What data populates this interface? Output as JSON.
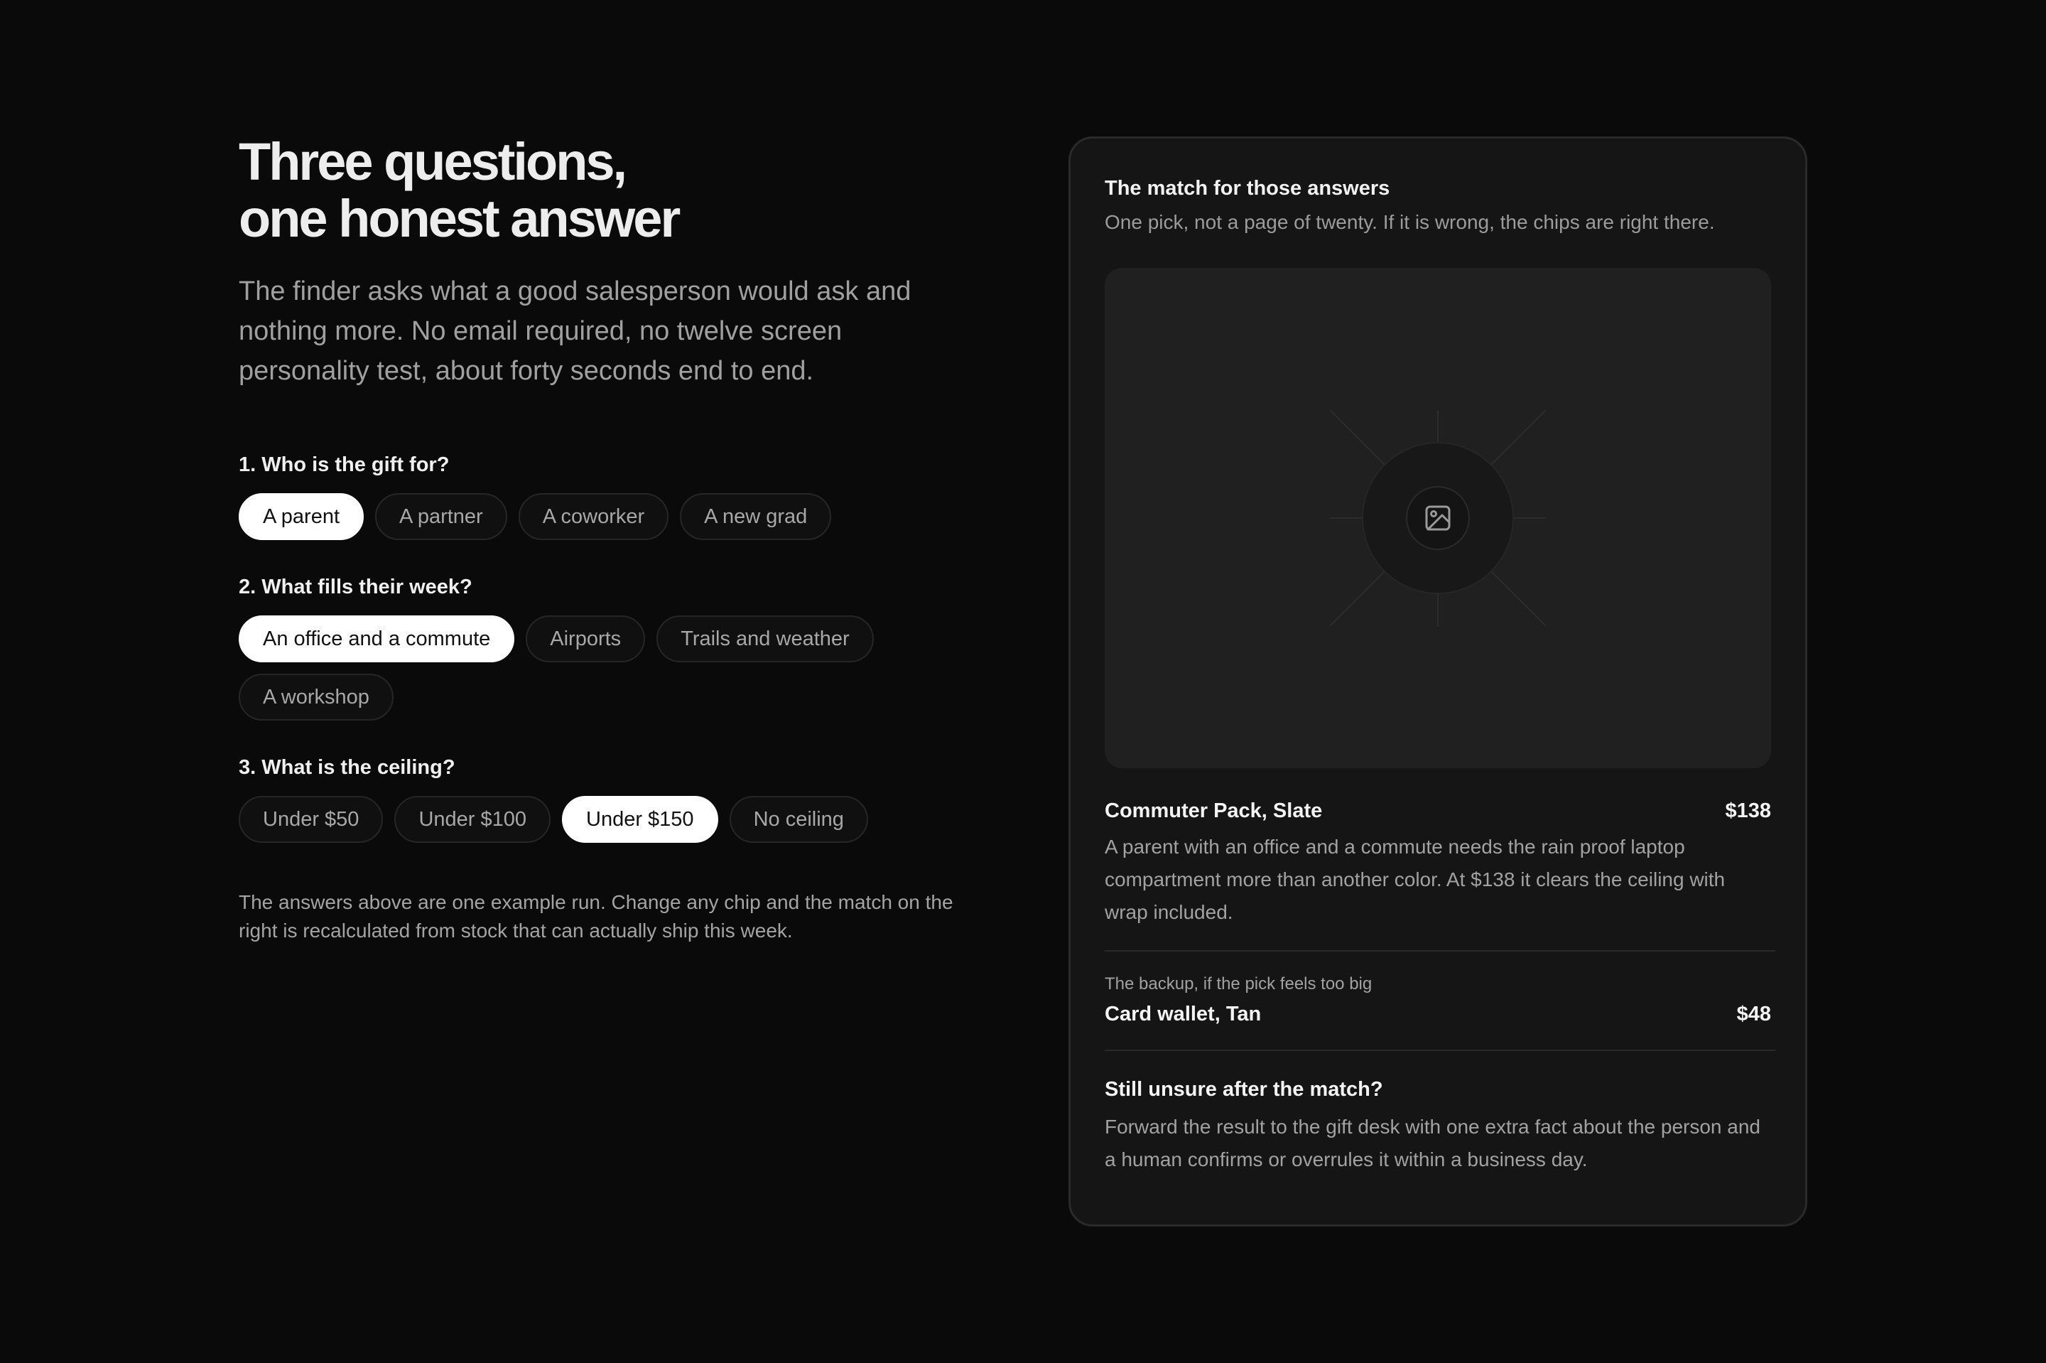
{
  "hero": {
    "title_line1": "Three questions,",
    "title_line2": "one honest answer",
    "lede": "The finder asks what a good salesperson would ask and nothing more. No email required, no twelve screen personality test, about forty seconds end to end."
  },
  "questions": [
    {
      "label": "1. Who is the gift for?",
      "options": [
        "A parent",
        "A partner",
        "A coworker",
        "A new grad"
      ],
      "selected": "A parent"
    },
    {
      "label": "2. What fills their week?",
      "options": [
        "An office and a commute",
        "Airports",
        "Trails and weather",
        "A workshop"
      ],
      "selected": "An office and a commute"
    },
    {
      "label": "3. What is the ceiling?",
      "options": [
        "Under $50",
        "Under $100",
        "Under $150",
        "No ceiling"
      ],
      "selected": "Under $150"
    }
  ],
  "note": "The answers above are one example run. Change any chip and the match on the right is recalculated from stock that can actually ship this week.",
  "match": {
    "title": "The match for those answers",
    "subtitle": "One pick, not a page of twenty. If it is wrong, the chips are right there.",
    "image_icon": "image-placeholder-icon",
    "product": {
      "name": "Commuter Pack, Slate",
      "price": "$138",
      "description": "A parent with an office and a commute needs the rain proof laptop compartment more than another color. At $138 it clears the ceiling with wrap included."
    },
    "backup": {
      "label": "The backup, if the pick feels too big",
      "name": "Card wallet, Tan",
      "price": "$48"
    },
    "unsure": {
      "title": "Still unsure after the match?",
      "description": "Forward the result to the gift desk with one extra fact about the person and a human confirms or overrules it within a business day."
    }
  },
  "colors": {
    "background": "#0a0a0a",
    "card": "#151515",
    "chip_active": "#ffffff",
    "muted_text": "#a2a2a2"
  }
}
